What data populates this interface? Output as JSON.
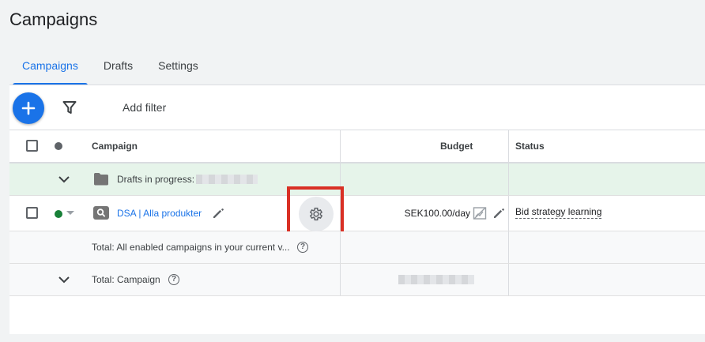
{
  "page": {
    "title": "Campaigns"
  },
  "tabs": [
    {
      "label": "Campaigns",
      "active": true
    },
    {
      "label": "Drafts",
      "active": false
    },
    {
      "label": "Settings",
      "active": false
    }
  ],
  "toolbar": {
    "add_filter_label": "Add filter"
  },
  "table": {
    "headers": {
      "campaign": "Campaign",
      "budget": "Budget",
      "status": "Status"
    },
    "drafts_row": {
      "label": "Drafts in progress:"
    },
    "campaign_row": {
      "name": "DSA | Alla produkter",
      "budget": "SEK100.00/day",
      "status": "Bid strategy learning",
      "status_color": "#188038"
    },
    "total_enabled_row": {
      "label": "Total: All enabled campaigns in your current v..."
    },
    "total_campaign_row": {
      "label": "Total: Campaign"
    }
  },
  "colors": {
    "accent": "#1a73e8",
    "highlight": "#d93025"
  }
}
